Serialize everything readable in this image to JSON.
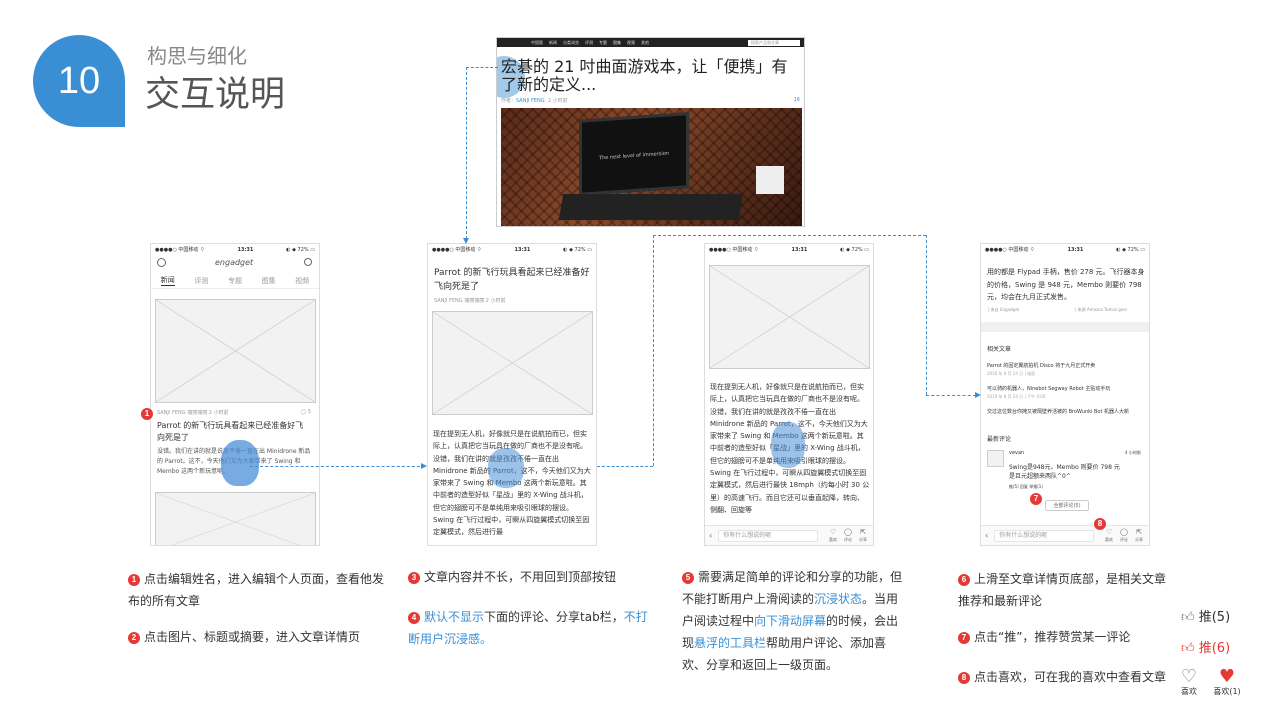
{
  "header": {
    "number": "10",
    "subtitle": "构思与细化",
    "title": "交互说明"
  },
  "screenshot": {
    "nav": [
      "中国版",
      "新闻",
      "分类浏览",
      "评测",
      "专题",
      "图集",
      "视频",
      "其他"
    ],
    "search": "搜索产品和文章",
    "headline": "宏碁的 21 吋曲面游戏本，让「便携」有了新的定义...",
    "author_prefix": "作者：",
    "author": "SANJI FENG",
    "time": "2 小时前",
    "count": "16",
    "monitor_text": "The next level of immersion"
  },
  "phone1": {
    "carrier": "●●●●○ 中国移动 ⌔",
    "time": "13:31",
    "battery": "◐ ◆ 72% ▭",
    "logo": "engadget",
    "tabs": [
      "新闻",
      "评测",
      "专题",
      "图集",
      "视频"
    ],
    "meta": "SANJI FENG 瑞丽瑞丽   2 小时前",
    "comments": "◯ 5",
    "headline": "Parrot 的新飞行玩具看起来已经准备好飞向死是了",
    "summary": "没错。我们在讲的就是说放不倦一直在出 Minidrone 新品的 Parrot。这不，今天他们又为大家带来了 Swing 和 Membo 这两个新玩意呢。"
  },
  "phone2": {
    "carrier": "●●●●○ 中国移动 ⌔",
    "time": "13:31",
    "battery": "◐ ◆ 72% ▭",
    "headline": "Parrot 的新飞行玩具看起来已经准备好飞向死是了",
    "meta": "SANJI FENG 瑞丽瑞丽   2 小时前",
    "body": "现在提到无人机，好像就只是在说航拍而已，但实际上，认真把它当玩具在做的厂商也不是没有呢。没错，我们在讲的就是孜孜不倦一直在出 Minidrone 新品的 Parrot，这不，今天他们又为大家带来了 Swing 和 Membo 这两个新玩意啦。其中前者的造型好似「星战」里的 X-Wing 战斗机，但它的翅膀可不是单纯用来吸引眼球的摆设。Swing 在飞行过程中，可瞬从四旋翼模式切换至固定翼模式，然后进行最"
  },
  "phone3": {
    "carrier": "●●●●○ 中国移动 ⌔",
    "time": "13:31",
    "battery": "◐ ◆ 72% ▭",
    "body": "现在提到无人机，好像就只是在说航拍而已，但实际上，认真把它当玩具在做的厂商也不是没有呢。没错，我们在讲的就是孜孜不倦一直在出 Minidrone 新品的 Parrot，这不，今天他们又为大家带来了 Swing 和 Membo 这两个新玩意啦。其中前者的造型好似「星战」里的 X-Wing 战斗机，但它的翅膀可不是单纯用来吸引眼球的摆设。Swing 在飞行过程中，可瞬从四旋翼模式切换至固定翼模式，然后进行最快 18mph（约每小时 30 公里）的高速飞行。而且它还可以垂直起降，转向、侧翻、回旋等",
    "comment_placeholder": "你有什么想说的呢",
    "icons": [
      "喜欢",
      "评论",
      "分享"
    ]
  },
  "phone4": {
    "carrier": "●●●●○ 中国移动 ⌔",
    "time": "13:31",
    "battery": "◐ ◆ 72% ▭",
    "body": "用的都是 Flypad 手柄，售价 278 元。飞行器本身的价格，Swing 是 948 元，Membo 则要价 798 元，均会在九月正式发售。",
    "source_left": "│ 来自 Engadget",
    "source_right": "│ 来源 Amazon Tomas gear",
    "related_title": "相关文章",
    "related": [
      {
        "t": "Parrot 的固定翼航拍机 Disco 将于九月正式开卖",
        "d": "2016 年 8 月 24 日 | 瑞丽"
      },
      {
        "t": "可以骑的机器人，Ninebot Segway Robot 主贴动手玩",
        "d": "2016 年 8 月 24 日 | 下午 4:00"
      },
      {
        "t": "交过这位数台你摊又被隔壁养活被的 BroWunki Bot 机器人大新",
        "d": ""
      }
    ],
    "comments_title": "最新评论",
    "commenter": "vevan",
    "comment_time": "4 小时前",
    "comment": "Swing是948元，Membo 则要价 798 元\n是且元超额来两队^0^",
    "comment_actions": "推(5)  回复  举报(1)",
    "all_comments": "全部评论(5)",
    "comment_placeholder": "你有什么想说的呢",
    "icons": [
      "喜欢",
      "评论",
      "分享"
    ]
  },
  "notes": {
    "n1": "点击编辑姓名，进入编辑个人页面，查看他发布的所有文章",
    "n2": "点击图片、标题或摘要，进入文章详情页",
    "n3": "文章内容并不长，不用回到顶部按钮",
    "n4a": "默认不显示",
    "n4b": "下面的评论、分享tab栏，",
    "n4c": "不打断用户沉浸感。",
    "n5a": "需要满足简单的评论和分享的功能，但不能打断用户上滑阅读的",
    "n5b": "沉浸状态",
    "n5c": "。当用户阅读过程中",
    "n5d": "向下滑动屏幕",
    "n5e": "的时候，会出现",
    "n5f": "悬浮的工具栏",
    "n5g": "帮助用户评论、添加喜欢、分享和返回上一级页面。",
    "n6": "上滑至文章详情页底部，是相关文章推荐和最新评论",
    "n7": "点击“推”，推荐赞赏某一评论",
    "n8": "点击喜欢，可在我的喜欢中查看文章"
  },
  "legend": {
    "push_default": "推(5)",
    "push_active": "推(6)",
    "like_default": "喜欢",
    "like_active": "喜欢(1)"
  },
  "colors": {
    "accent": "#3a8fd4",
    "red": "#e53935"
  }
}
